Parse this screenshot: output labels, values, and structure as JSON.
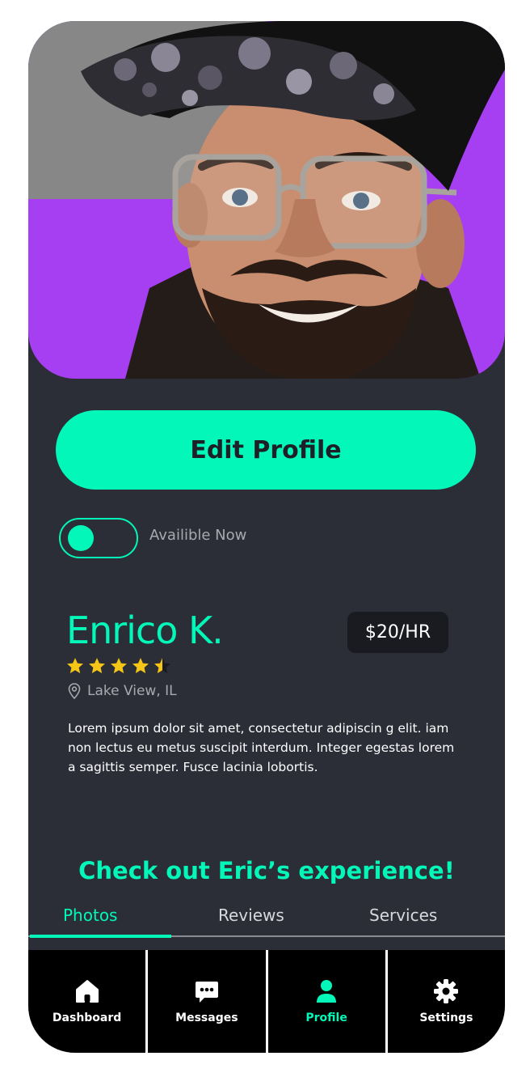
{
  "profile": {
    "edit_label": "Edit Profile",
    "availability_label": "Availible Now",
    "available": true,
    "name": "Enrico K.",
    "rate": "$20/HR",
    "rating": 4.5,
    "location": "Lake View, IL",
    "bio": "Lorem ipsum dolor sit amet, consectetur adipiscin g elit. iam non lectus eu metus suscipit interdum. Integer egestas lorem a sagittis semper. Fusce lacinia lobortis."
  },
  "experience": {
    "title": "Check out Eric’s experience!",
    "tabs": [
      {
        "label": "Photos",
        "active": true
      },
      {
        "label": "Reviews",
        "active": false
      },
      {
        "label": "Services",
        "active": false
      }
    ]
  },
  "nav": {
    "items": [
      {
        "label": "Dashboard",
        "icon": "home-icon",
        "active": false
      },
      {
        "label": "Messages",
        "icon": "chat-bubble-icon",
        "active": false
      },
      {
        "label": "Profile",
        "icon": "user-icon",
        "active": true
      },
      {
        "label": "Settings",
        "icon": "gear-icon",
        "active": false
      }
    ]
  },
  "colors": {
    "accent": "#03f7b9",
    "background": "#2b2e37",
    "hero_purple": "#a63ff2",
    "nav_background": "#000000"
  }
}
